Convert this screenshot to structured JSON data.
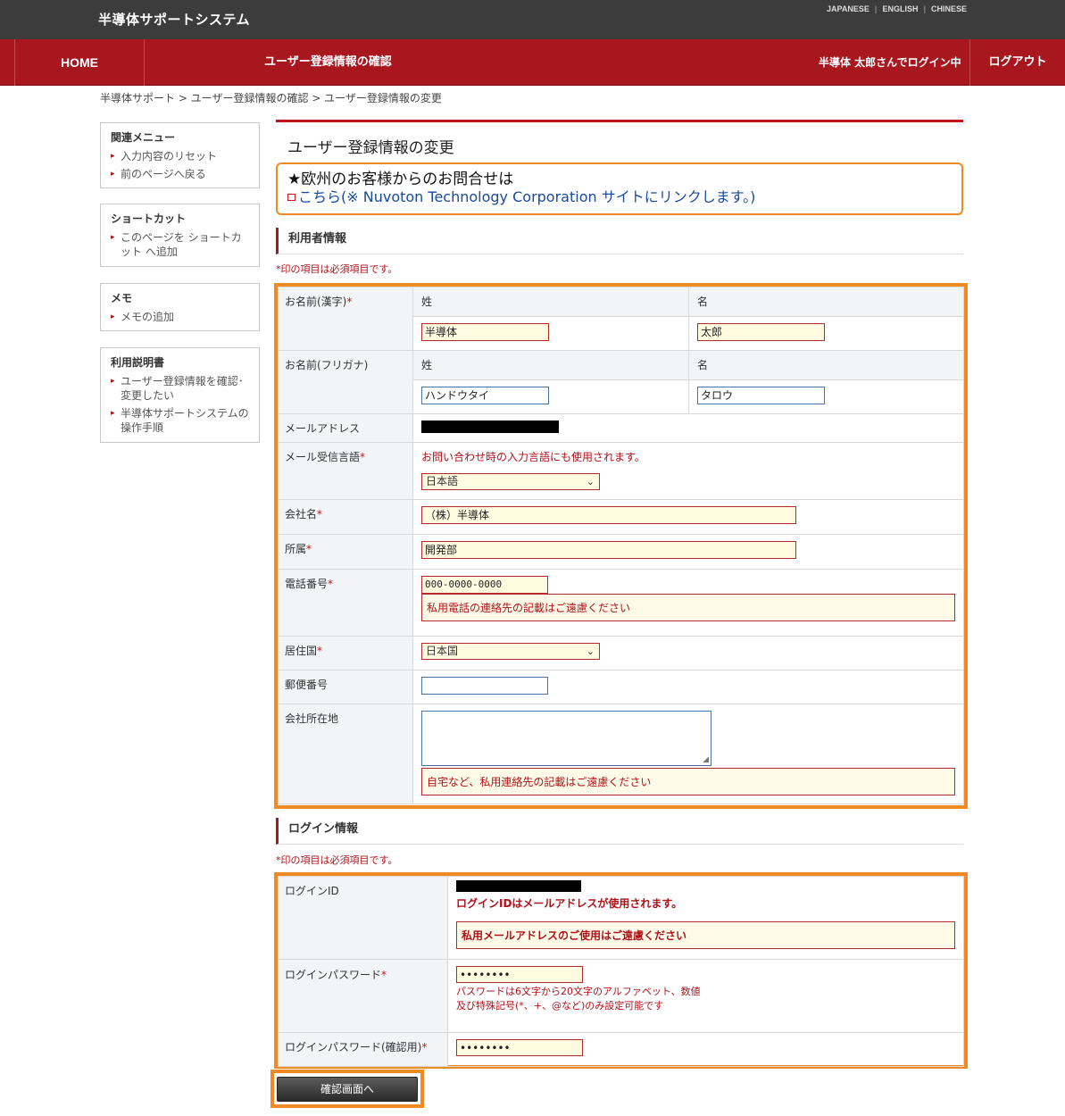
{
  "header": {
    "site_title": "半導体サポートシステム",
    "languages": [
      "JAPANESE",
      "ENGLISH",
      "CHINESE"
    ]
  },
  "nav": {
    "home": "HOME",
    "page_title": "ユーザー登録情報の確認",
    "user_status": "半導体 太郎さんでログイン中",
    "logout": "ログアウト"
  },
  "breadcrumb": "半導体サポート > ユーザー登録情報の確認 > ユーザー登録情報の変更",
  "sidebar": {
    "related": {
      "title": "関連メニュー",
      "items": [
        "入力内容のリセット",
        "前のページへ戻る"
      ]
    },
    "shortcut": {
      "title": "ショートカット",
      "items": [
        "このページを ショートカット へ追加"
      ]
    },
    "memo": {
      "title": "メモ",
      "items": [
        "メモの追加"
      ]
    },
    "manual": {
      "title": "利用説明書",
      "items": [
        "ユーザー登録情報を確認･変更したい",
        "半導体サポートシステムの操作手順"
      ]
    }
  },
  "main": {
    "title": "ユーザー登録情報の変更",
    "notice": {
      "line1": "★欧州のお客様からのお問合せは",
      "line2": "こちら(※ Nuvoton Technology Corporation サイトにリンクします。)"
    },
    "user_section": {
      "heading": "利用者情報",
      "required_note": "*印の項目は必須項目です。",
      "name_kanji_label": "お名前(漢字)",
      "name_kana_label": "お名前(フリガナ)",
      "last_label": "姓",
      "first_label": "名",
      "last_kanji": "半導体",
      "first_kanji": "太郎",
      "last_kana": "ハンドウタイ",
      "first_kana": "タロウ",
      "email_label": "メールアドレス",
      "mail_lang_label": "メール受信言語",
      "mail_lang_note": "お問い合わせ時の入力言語にも使用されます。",
      "mail_lang_value": "日本語",
      "company_label": "会社名",
      "company_value": "（株）半導体",
      "dept_label": "所属",
      "dept_value": "開発部",
      "phone_label": "電話番号",
      "phone_value": "000-0000-0000",
      "phone_warning": "私用電話の連絡先の記載はご遠慮ください",
      "country_label": "居住国",
      "country_value": "日本国",
      "postal_label": "郵便番号",
      "address_label": "会社所在地",
      "address_warning": "自宅など、私用連絡先の記載はご遠慮ください"
    },
    "login_section": {
      "heading": "ログイン情報",
      "required_note": "*印の項目は必須項目です。",
      "login_id_label": "ログインID",
      "login_id_note": "ログインIDはメールアドレスが使用されます。",
      "login_id_warning": "私用メールアドレスのご使用はご遠慮ください",
      "password_label": "ログインパスワード",
      "password_value": "••••••••",
      "password_note1": "パスワードは6文字から20文字のアルファベット、数値",
      "password_note2": "及び特殊記号(*、+、@など)のみ設定可能です",
      "password_confirm_label": "ログインパスワード(確認用)",
      "password_confirm_value": "••••••••"
    },
    "submit_label": "確認画面へ"
  },
  "colors": {
    "header_bg": "#3c3c3c",
    "nav_bg": "#a8161e",
    "highlight": "#f08a24",
    "required": "#c0141c"
  }
}
